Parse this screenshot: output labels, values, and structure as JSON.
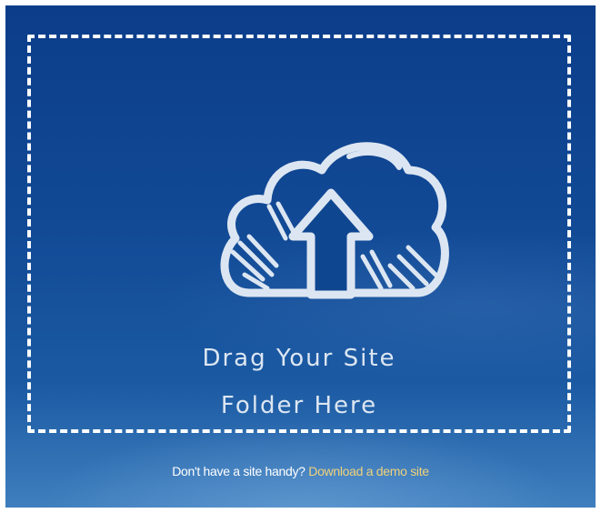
{
  "dropzone": {
    "line1": "Drag Your Site",
    "line2": "Folder Here",
    "icon": "cloud-upload-icon"
  },
  "footer": {
    "prompt": "Don't have a site handy?",
    "link_label": "Download a demo site"
  },
  "colors": {
    "background": "#1a4f97",
    "text": "#dce6f2",
    "link": "#f0d27a"
  }
}
